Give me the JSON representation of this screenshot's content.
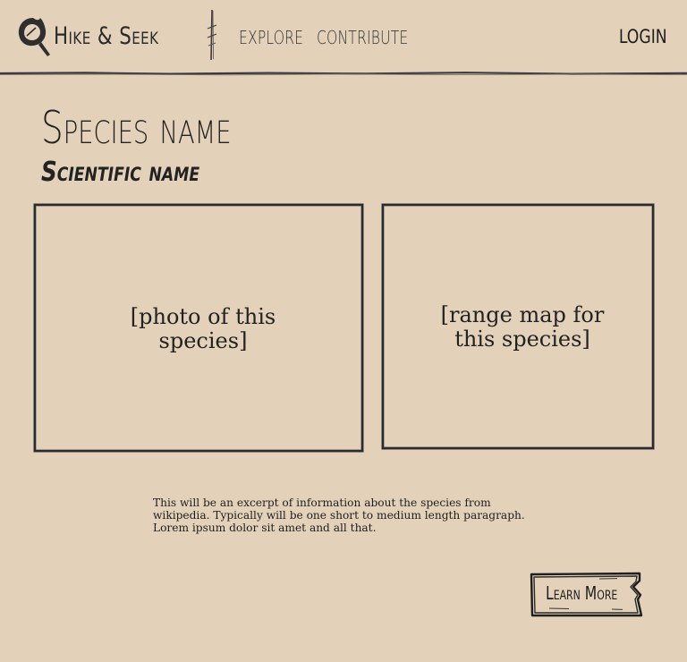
{
  "header": {
    "brand": "Hike & Seek",
    "nav": {
      "explore": "EXPLORE",
      "contribute": "CONTRIBUTE",
      "login": "LOGIN"
    }
  },
  "species": {
    "name": "Species name",
    "scientific_name": "Scientific name"
  },
  "media": {
    "photo_placeholder": "[photo of this species]",
    "range_map_placeholder": "[range map for this species]"
  },
  "excerpt": "This will be an excerpt of information about the species from wikipedia. Typically will be one short to medium length paragraph. Lorem ipsum dolor sit amet and all that.",
  "actions": {
    "learn_more": "Learn More"
  },
  "colors": {
    "background": "#e3d2b9",
    "ink": "#1e1e1e"
  }
}
